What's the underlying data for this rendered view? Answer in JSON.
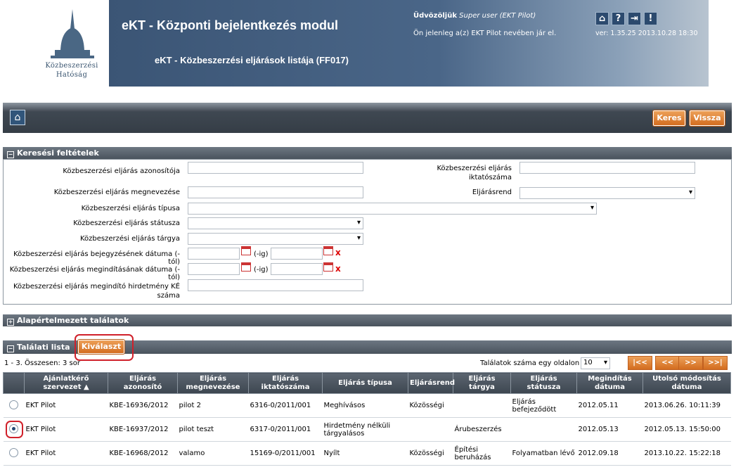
{
  "header": {
    "org_line1": "Közbeszerzési",
    "org_line2": "Hatóság",
    "app_title": "eKT - Központi bejelentkezés modul",
    "page_title": "eKT - Közbeszerzési eljárások listája (FF017)",
    "welcome_prefix": "Üdvözöljük",
    "welcome_user": "Super user (EKT Pilot)",
    "acting_as": "Ön jelenleg a(z) EKT Pilot nevében jár el.",
    "version": "ver: 1.35.25 2013.10.28 18:30",
    "icons": [
      "home-icon",
      "help-icon",
      "logout-icon",
      "alert-icon"
    ],
    "icon_glyphs": [
      "⌂",
      "?",
      "⇥",
      "!"
    ]
  },
  "toolbar": {
    "search_label": "Keres",
    "back_label": "Vissza"
  },
  "search": {
    "section_title": "Keresési feltételek",
    "id_label": "Közbeszerzési eljárás azonosítója",
    "filing_label": "Közbeszerzési eljárás iktatószáma",
    "name_label": "Közbeszerzési eljárás megnevezése",
    "procedure_order_label": "Eljárásrend",
    "type_label": "Közbeszerzési eljárás típusa",
    "status_label": "Közbeszerzési eljárás státusza",
    "subject_label": "Közbeszerzési eljárás tárgya",
    "reg_date_label": "Közbeszerzési eljárás bejegyzésének dátuma (-tól)",
    "start_date_label": "Közbeszerzési eljárás megindításának dátuma (-tól)",
    "until_label": "(-ig)",
    "clear_glyph": "x",
    "notice_label": "Közbeszerzési eljárás megindító hirdetmény KÉ száma"
  },
  "defaults_section": {
    "title": "Alapértelmezett találatok"
  },
  "results": {
    "section_title": "Találati lista",
    "select_label": "Kiválaszt",
    "summary": "1 - 3. Összesen: 3 sor",
    "page_size_label": "Találatok száma egy oldalon",
    "page_size": "10",
    "pager": [
      "|<<",
      "<<",
      ">>",
      ">>|"
    ],
    "columns": [
      "Ajánlatkérő szervezet ▲",
      "Eljárás azonosító",
      "Eljárás megnevezése",
      "Eljárás iktatószáma",
      "Eljárás típusa",
      "Eljárásrend",
      "Eljárás tárgya",
      "Eljárás státusza",
      "Megindítás dátuma",
      "Utolsó módosítás dátuma"
    ],
    "rows": [
      {
        "selected": false,
        "org": "EKT Pilot",
        "id": "KBE-16936/2012",
        "name": "pilot 2",
        "filing": "6316-0/2011/001",
        "type": "Meghívásos",
        "order": "Közösségi",
        "subject": "",
        "status": "Eljárás befejeződött",
        "start": "2012.05.11",
        "modified": "2013.06.26. 10:11:39"
      },
      {
        "selected": true,
        "org": "EKT Pilot",
        "id": "KBE-16937/2012",
        "name": "pilot teszt",
        "filing": "6317-0/2011/001",
        "type": "Hirdetmény nélküli tárgyalásos",
        "order": "",
        "subject": "Árubeszerzés",
        "status": "",
        "start": "2012.05.13",
        "modified": "2012.05.13. 15:50:00"
      },
      {
        "selected": false,
        "org": "EKT Pilot",
        "id": "KBE-16968/2012",
        "name": "valamo",
        "filing": "15169-0/2011/001",
        "type": "Nyílt",
        "order": "Közösségi",
        "subject": "Építési beruházás",
        "status": "Folyamatban lévő",
        "start": "2012.09.18",
        "modified": "2013.10.22. 15:22:18"
      }
    ]
  }
}
